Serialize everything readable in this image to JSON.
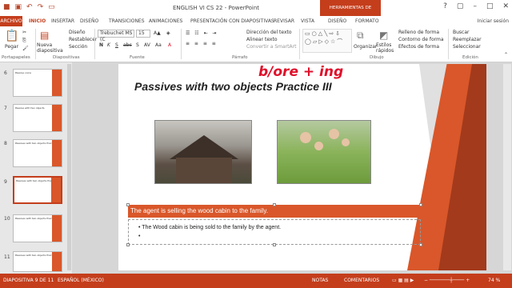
{
  "app": {
    "title": "ENGLISH VI CS 22 - PowerPoint",
    "contextual_tools": "HERRAMIENTAS DE SMARTART",
    "sign_in": "Iniciar sesión"
  },
  "tabs": [
    {
      "label": "ARCHIVO"
    },
    {
      "label": "INICIO"
    },
    {
      "label": "INSERTAR"
    },
    {
      "label": "DISEÑO"
    },
    {
      "label": "TRANSICIONES"
    },
    {
      "label": "ANIMACIONES"
    },
    {
      "label": "PRESENTACIÓN CON DIAPOSITIVAS"
    },
    {
      "label": "REVISAR"
    },
    {
      "label": "VISTA"
    },
    {
      "label": "DISEÑO"
    },
    {
      "label": "FORMATO"
    }
  ],
  "ribbon": {
    "clipboard": {
      "paste": "Pegar",
      "group": "Portapapeles"
    },
    "slides": {
      "new_slide": "Nueva diapositiva",
      "layout": "Diseño",
      "reset": "Restablecer",
      "section": "Sección",
      "group": "Diapositivas"
    },
    "font": {
      "name": "Trebuchet MS (C",
      "size": "15",
      "group": "Fuente",
      "buttons": [
        "N",
        "K",
        "S",
        "abc",
        "S",
        "AV",
        "Aa",
        "A"
      ]
    },
    "paragraph": {
      "text_direction": "Dirección del texto",
      "align_text": "Alinear texto",
      "convert_smartart": "Convertir a SmartArt",
      "group": "Párrafo"
    },
    "drawing": {
      "arrange": "Organizar",
      "quick_styles": "Estilos rápidos",
      "shape_fill": "Relleno de forma",
      "shape_outline": "Contorno de forma",
      "shape_effects": "Efectos de forma",
      "group": "Dibujo"
    },
    "editing": {
      "find": "Buscar",
      "replace": "Reemplazar",
      "select": "Seleccionar",
      "group": "Edición"
    }
  },
  "thumbnails": [
    {
      "num": "6",
      "title": "Passive voice"
    },
    {
      "num": "7",
      "title": "Passive with two objects"
    },
    {
      "num": "8",
      "title": "Passives with two objects Practice II"
    },
    {
      "num": "9",
      "title": "Passives with two objects Practice III",
      "selected": true
    },
    {
      "num": "10",
      "title": "Passives with two objects Practice IV"
    },
    {
      "num": "11",
      "title": "Passives with two objects Practice V"
    }
  ],
  "slide": {
    "title": "Passives with two objects Practice III",
    "annotation": "b/ore + ing",
    "prompt": "The agent is selling the wood cabin to the family.",
    "bullets": [
      "The Wood cabin is being sold to the family by the agent.",
      ""
    ]
  },
  "status": {
    "slide_info": "DIAPOSITIVA 9 DE 11",
    "language": "ESPAÑOL (MÉXICO)",
    "notes": "NOTAS",
    "comments": "COMENTARIOS",
    "zoom": "74 %"
  },
  "colors": {
    "accent": "#c43e1c",
    "slide_orange": "#d9572a",
    "ink": "#e0102a"
  }
}
